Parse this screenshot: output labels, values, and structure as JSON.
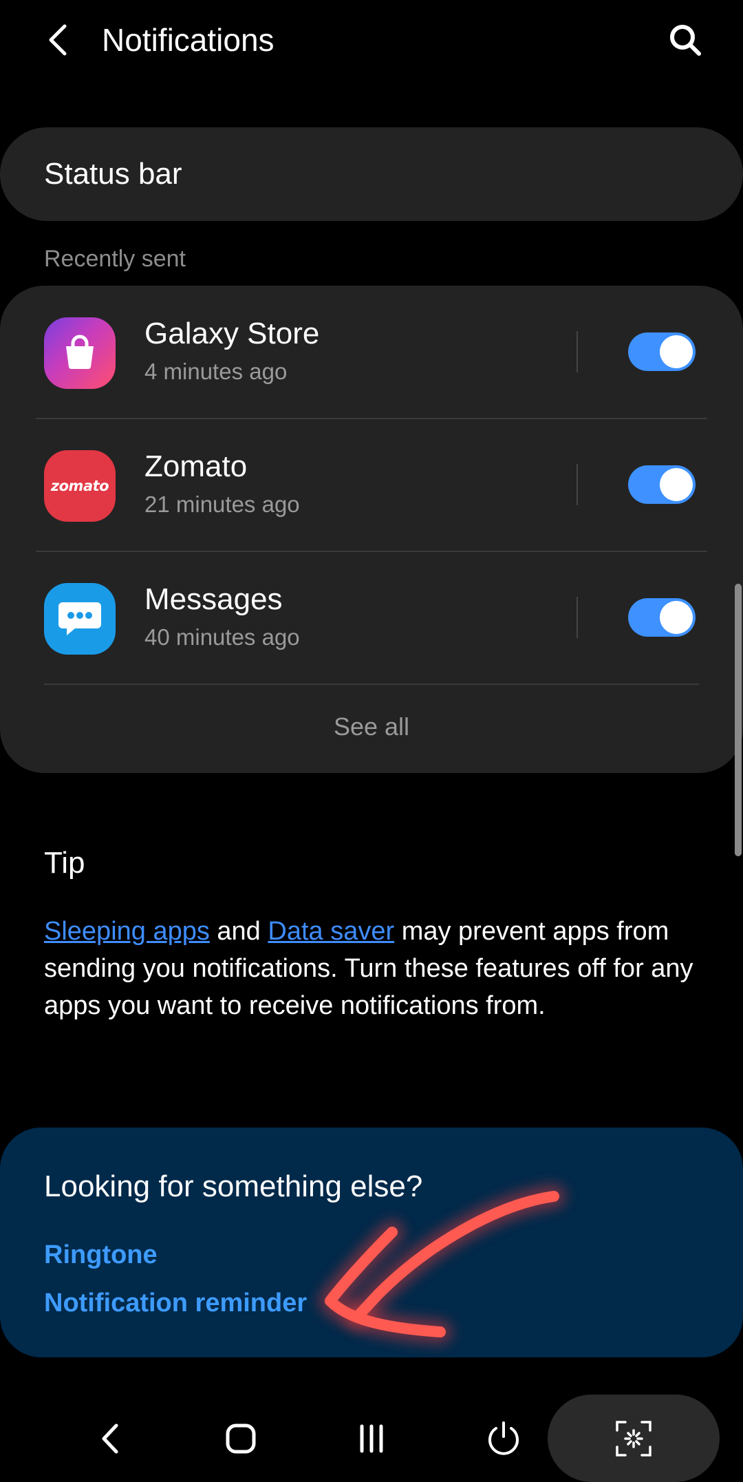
{
  "header": {
    "title": "Notifications"
  },
  "status_bar_row": {
    "label": "Status bar"
  },
  "recently_sent": {
    "section_label": "Recently sent",
    "apps": [
      {
        "name": "Galaxy Store",
        "time": "4 minutes ago",
        "enabled": true,
        "icon": "galaxy-store-icon"
      },
      {
        "name": "Zomato",
        "time": "21 minutes ago",
        "enabled": true,
        "icon": "zomato-icon",
        "icon_text": "zomato"
      },
      {
        "name": "Messages",
        "time": "40 minutes ago",
        "enabled": true,
        "icon": "messages-icon"
      }
    ],
    "see_all": "See all"
  },
  "tip": {
    "title": "Tip",
    "link1": "Sleeping apps",
    "and": " and ",
    "link2": "Data saver",
    "rest": " may prevent apps from sending you notifications. Turn these features off for any apps you want to receive notifications from."
  },
  "looking_else": {
    "title": "Looking for something else?",
    "links": [
      "Ringtone",
      "Notification reminder"
    ]
  },
  "colors": {
    "accent": "#3e91ff",
    "card": "#232323",
    "info_card": "#00294a",
    "annotation": "#ff4a4a"
  }
}
